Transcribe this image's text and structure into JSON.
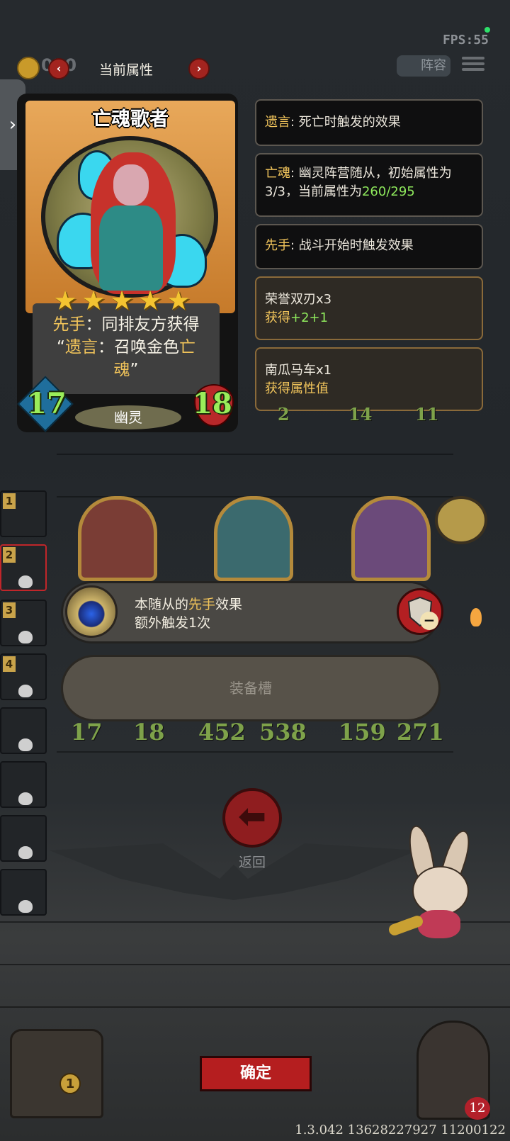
{
  "hud": {
    "fps": "FPS:55",
    "coins": "020",
    "lineup_label": "阵容"
  },
  "header": {
    "title": "当前属性"
  },
  "card": {
    "name": "亡魂歌者",
    "stars": 5,
    "desc_kw1": "先手",
    "desc_part1": "：同排友方获得",
    "desc_quote_open": "“",
    "desc_kw2": "遗言",
    "desc_part2": "：召唤金色",
    "desc_kw3": "亡",
    "desc_kw4": "魂",
    "desc_quote_close": "”",
    "attack": "17",
    "health": "18",
    "tribe": "幽灵"
  },
  "panels": {
    "deathrattle": {
      "kw": "遗言",
      "text": ": 死亡时触发的效果"
    },
    "soul": {
      "kw": "亡魂",
      "text1": ": 幽灵阵营随从，初始属性为",
      "text2": "3/3，当前属性为",
      "value": "260/295"
    },
    "first_strike": {
      "kw": "先手",
      "text": ": 战斗开始时触发效果"
    },
    "item1": {
      "name": "荣誉双刃x3",
      "label": "获得",
      "value": "+2+1"
    },
    "item2": {
      "name": "南瓜马车x1",
      "value": "获得属性值"
    }
  },
  "board": {
    "stats": [
      {
        "atk": "17",
        "hp": "18"
      },
      {
        "atk": "452",
        "hp": "538"
      },
      {
        "atk": "159",
        "hp": "271"
      }
    ],
    "top_row_stats": [
      "2",
      "14",
      "11"
    ],
    "slots": [
      "1",
      "2",
      "3",
      "4"
    ]
  },
  "equip": {
    "line1_pre": "本随从的",
    "line1_kw": "先手",
    "line1_post": "效果",
    "line2": "额外触发1次",
    "slot_label": "装备槽"
  },
  "actions": {
    "back_label": "返回",
    "confirm_label": "确定"
  },
  "footer": {
    "chest_count": "1",
    "hero_level": "12",
    "version": "1.3.042 13628227927 11200122"
  },
  "colors": {
    "gold_keyword": "#f0c35a",
    "green_value": "#8ee85c",
    "red_button": "#b51e1f"
  }
}
